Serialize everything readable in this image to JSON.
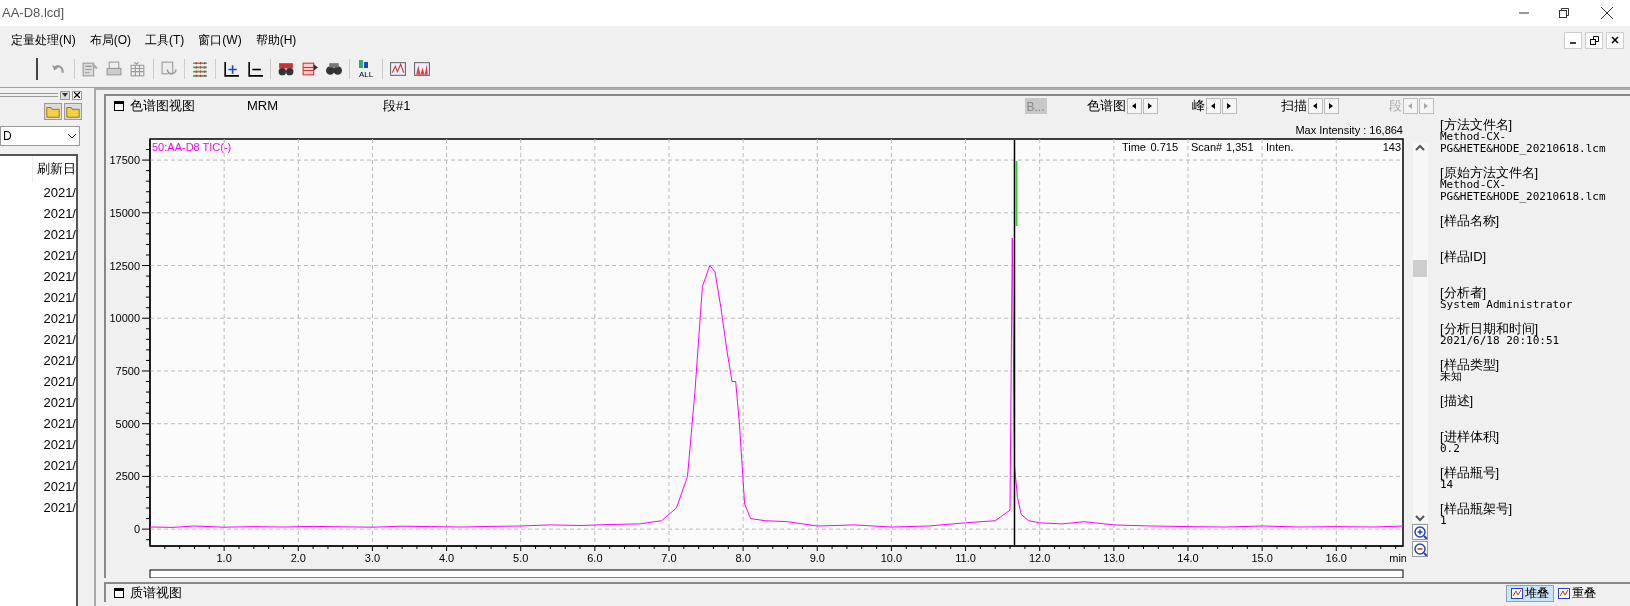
{
  "window": {
    "title": "AA-D8.lcd]"
  },
  "menu": [
    {
      "label": "定量处理(N)"
    },
    {
      "label": "布局(O)"
    },
    {
      "label": "工具(T)"
    },
    {
      "label": "窗口(W)"
    },
    {
      "label": "帮助(H)"
    }
  ],
  "toolbar": {
    "all_label": "ALL"
  },
  "left_panel": {
    "combo_value": "D",
    "list_header": "刷新日",
    "rows": [
      "2021/",
      "2021/",
      "2021/",
      "2021/",
      "2021/",
      "2021/",
      "2021/",
      "2021/",
      "2021/",
      "2021/",
      "2021/",
      "2021/",
      "2021/",
      "2021/",
      "2021/",
      "2021/"
    ]
  },
  "chromatogram_view": {
    "title": "色谱图视图",
    "mode": "MRM",
    "segment": "段#1",
    "b_button": {
      "label": "B...",
      "disabled": true
    },
    "navigators": [
      {
        "label": "色谱图",
        "disabled": false
      },
      {
        "label": "峰",
        "disabled": false
      },
      {
        "label": "扫描",
        "disabled": false
      },
      {
        "label": "段",
        "disabled": true
      }
    ],
    "max_intensity": "Max Intensity :  16,864",
    "cursor": {
      "time_label": "Time",
      "time": "0.715",
      "scan_label": "Scan#",
      "scan": "1,351",
      "inten_label": "Inten.",
      "inten": "143"
    },
    "chart_data": {
      "type": "line",
      "xlabel": "min",
      "grid": true,
      "ref_lines": [
        {
          "axis": "x",
          "value": 11.66
        }
      ],
      "xlim": [
        0,
        16.9
      ],
      "ylim": [
        -800,
        18500
      ],
      "xticks": [
        {
          "value": 1,
          "label": "1.0"
        },
        {
          "value": 2,
          "label": "2.0"
        },
        {
          "value": 3,
          "label": "3.0"
        },
        {
          "value": 4,
          "label": "4.0"
        },
        {
          "value": 5,
          "label": "5.0"
        },
        {
          "value": 6,
          "label": "6.0"
        },
        {
          "value": 7,
          "label": "7.0"
        },
        {
          "value": 8,
          "label": "8.0"
        },
        {
          "value": 9,
          "label": "9.0"
        },
        {
          "value": 10,
          "label": "10.0"
        },
        {
          "value": 11,
          "label": "11.0"
        },
        {
          "value": 12,
          "label": "12.0"
        },
        {
          "value": 13,
          "label": "13.0"
        },
        {
          "value": 14,
          "label": "14.0"
        },
        {
          "value": 15,
          "label": "15.0"
        },
        {
          "value": 16,
          "label": "16.0"
        }
      ],
      "yticks": [
        0,
        2500,
        5000,
        7500,
        10000,
        12500,
        15000,
        17500
      ],
      "x": [
        0,
        0.3,
        0.6,
        1,
        1.4,
        1.8,
        2.2,
        2.6,
        3,
        3.4,
        3.8,
        4.2,
        4.6,
        5,
        5.4,
        5.8,
        6.2,
        6.6,
        6.9,
        7.1,
        7.25,
        7.35,
        7.45,
        7.55,
        7.62,
        7.7,
        7.78,
        7.85,
        7.9,
        7.95,
        8.02,
        8.1,
        8.3,
        8.6,
        9,
        9.5,
        10,
        10.5,
        11,
        11.4,
        11.6,
        11.63,
        11.66,
        11.7,
        11.75,
        11.85,
        12,
        12.3,
        12.6,
        13,
        13.5,
        14,
        14.5,
        15,
        15.5,
        16,
        16.5,
        16.9
      ],
      "series": [
        {
          "name": "50:AA-D8 TIC(-)",
          "color": "#ff00ff",
          "values": [
            100,
            80,
            150,
            90,
            120,
            100,
            130,
            110,
            90,
            140,
            120,
            100,
            130,
            150,
            200,
            170,
            220,
            250,
            400,
            1000,
            2500,
            6500,
            11500,
            12500,
            12200,
            10500,
            8500,
            7000,
            7000,
            5000,
            1200,
            500,
            400,
            350,
            150,
            200,
            100,
            150,
            300,
            400,
            900,
            13800,
            3000,
            1500,
            700,
            400,
            300,
            250,
            350,
            200,
            150,
            120,
            100,
            150,
            100,
            120,
            100,
            150
          ]
        }
      ]
    }
  },
  "info": [
    {
      "label": "[方法文件名]",
      "value": "Method-CX-PG&HETE&HODE_20210618.lcm"
    },
    {
      "label": "[原始方法文件名]",
      "value": "Method-CX-PG&HETE&HODE_20210618.lcm"
    },
    {
      "label": "[样品名称]"
    },
    {
      "label": "[样品ID]"
    },
    {
      "label": "[分析者]",
      "value": "System Administrator"
    },
    {
      "label": "[分析日期和时间]",
      "value": "2021/6/18 20:10:51"
    },
    {
      "label": "[样品类型]",
      "value": "未知"
    },
    {
      "label": "[描述]"
    },
    {
      "label": "[进样体积]",
      "value": "0.2"
    },
    {
      "label": "[样品瓶号]",
      "value": "14"
    },
    {
      "label": "[样品瓶架号]",
      "value": "1"
    }
  ],
  "spectrum_view": {
    "title": "质谱视图"
  },
  "view_tabs": [
    {
      "label": "堆叠",
      "selected": true
    },
    {
      "label": "重叠",
      "selected": false
    }
  ]
}
